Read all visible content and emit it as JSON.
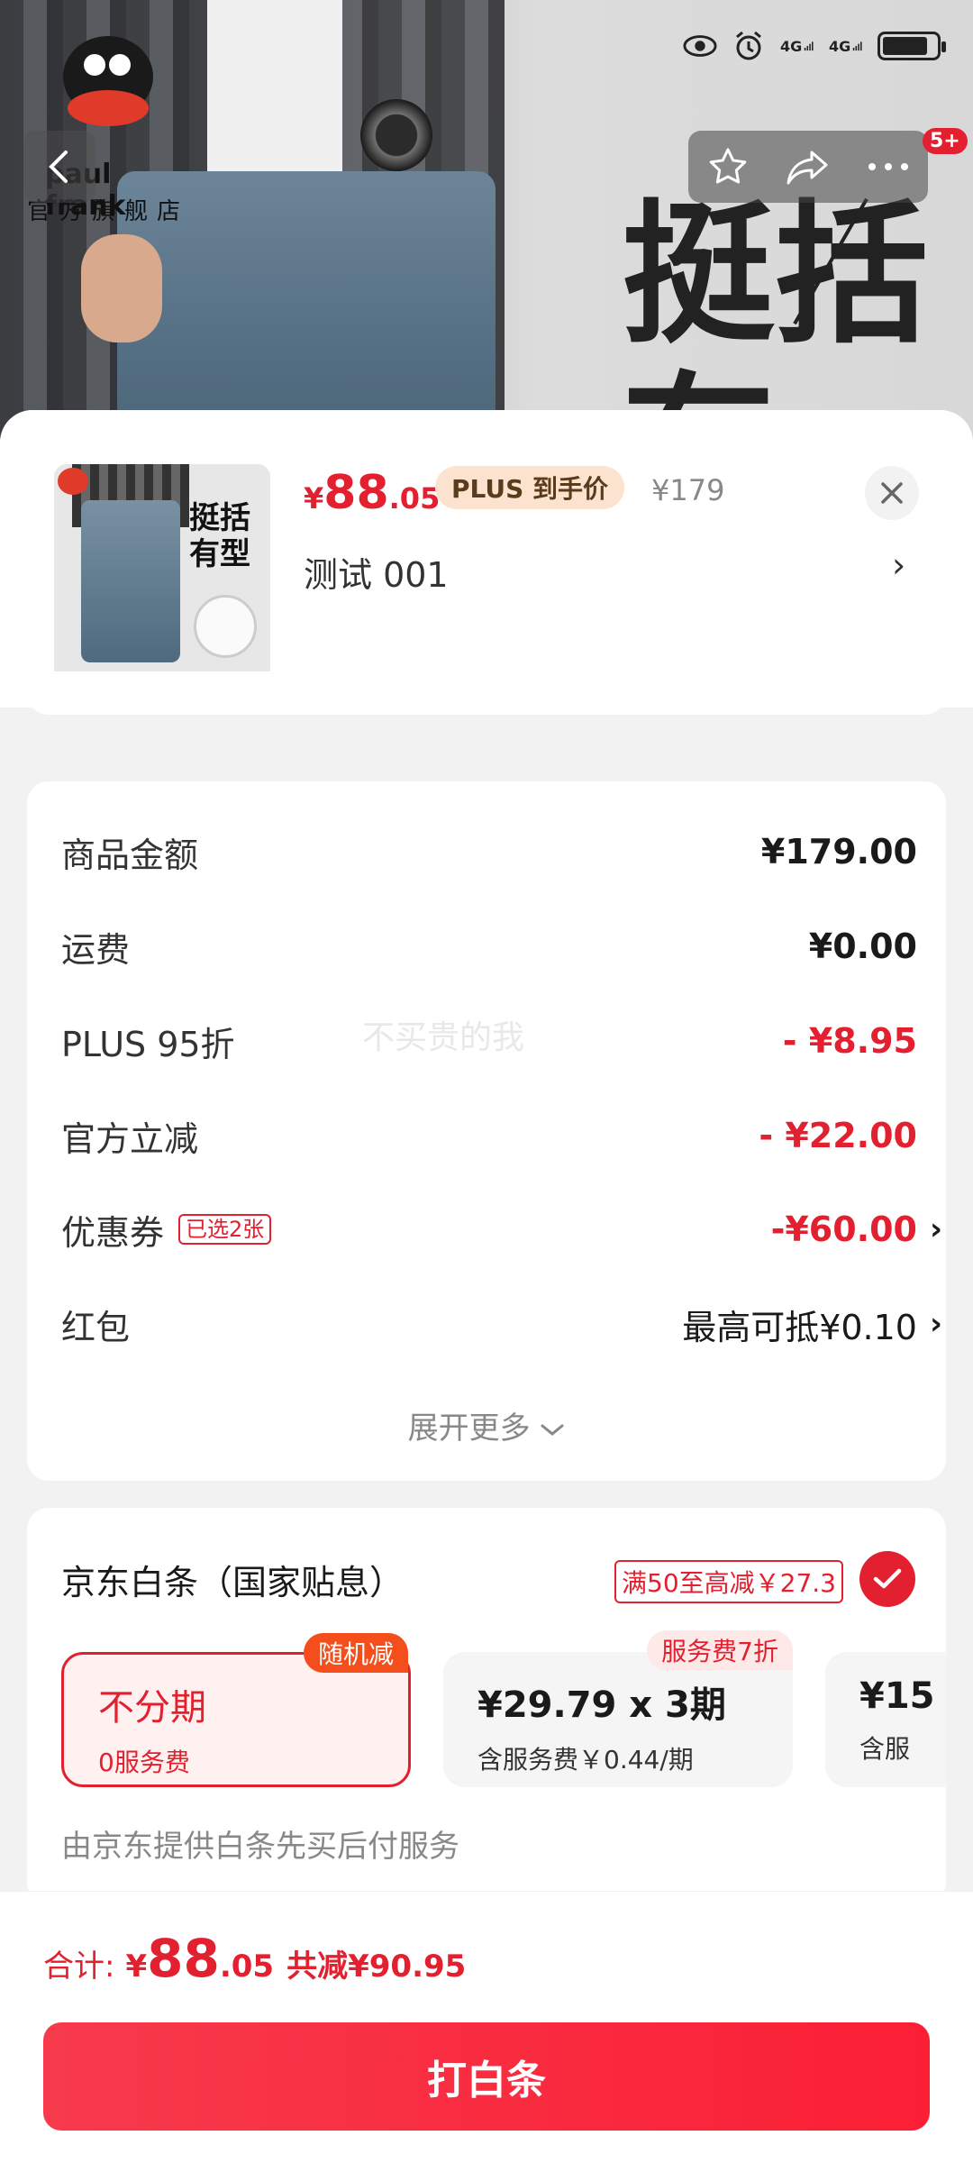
{
  "status": {
    "net1": "4G",
    "net2": "4G"
  },
  "brand": {
    "name": "paul frank",
    "sub": "官方旗舰店"
  },
  "background": {
    "big_text": "挺括有"
  },
  "actions": {
    "badge": "5+"
  },
  "product": {
    "price_yen": "¥",
    "price_int": "88",
    "price_dec": ".05",
    "plus_tag": "PLUS 到手价",
    "original_price": "¥179",
    "spec": "测试  001",
    "thumb_text": "挺括有型"
  },
  "costs": {
    "rows": [
      {
        "label": "商品金额",
        "value": "¥179.00"
      },
      {
        "label": "运费",
        "value": "¥0.00"
      },
      {
        "label": "PLUS 95折",
        "value": "- ¥8.95"
      },
      {
        "label": "官方立减",
        "value": "- ¥22.00"
      },
      {
        "label": "优惠券",
        "tag": "已选2张",
        "value": "-¥60.00"
      },
      {
        "label": "红包",
        "value": "最高可抵¥0.10"
      }
    ],
    "watermark": "不买贵的我",
    "expand": "展开更多"
  },
  "baitiao": {
    "title": "京东白条（国家贴息）",
    "promo": "满50至高减￥27.3",
    "plans": [
      {
        "main": "不分期",
        "sub": "0服务费",
        "tag": "随机减"
      },
      {
        "main": "¥29.79 x 3期",
        "sub": "含服务费￥0.44/期",
        "tag": "服务费7折"
      },
      {
        "main": "¥15",
        "sub": "含服"
      }
    ],
    "footer": "由京东提供白条先买后付服务"
  },
  "bottom": {
    "label": "合计:",
    "yen": "¥",
    "int": "88",
    "dec": ".05",
    "reduce": "共减¥90.95",
    "button": "打白条"
  },
  "colors": {
    "accent": "#e3202f",
    "button": "#fb1f35"
  }
}
